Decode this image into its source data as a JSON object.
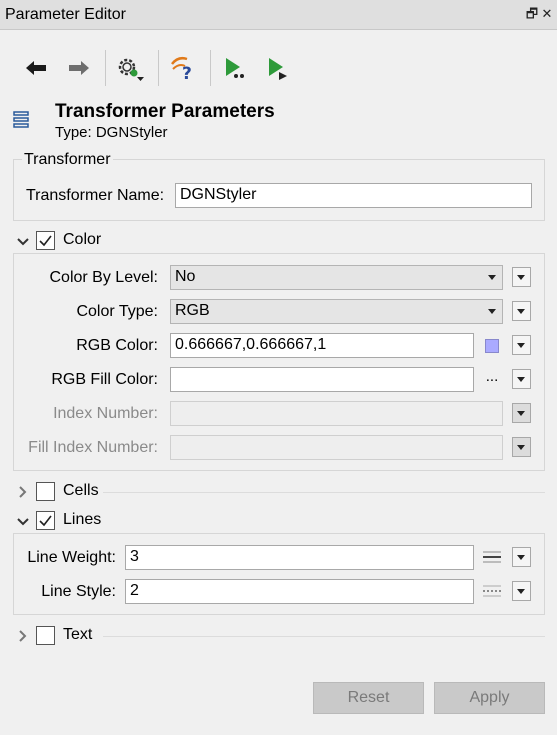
{
  "window": {
    "title": "Parameter Editor",
    "float_glyph": "🗗",
    "close_glyph": "✕"
  },
  "toolbar": {
    "buttons": [
      {
        "name": "back-arrow-icon"
      },
      {
        "name": "forward-arrow-icon"
      },
      {
        "name": "settings-gear-icon"
      },
      {
        "name": "help-icon"
      },
      {
        "name": "run-icon"
      },
      {
        "name": "run-to-this-icon"
      }
    ]
  },
  "header": {
    "title": "Transformer Parameters",
    "type_label": "Type: DGNStyler"
  },
  "transformer_group": {
    "legend": "Transformer",
    "name_label": "Transformer Name:",
    "name_value": "DGNStyler"
  },
  "color_section": {
    "label": "Color",
    "checked": true,
    "expanded": true,
    "color_by_level": {
      "label": "Color By Level:",
      "value": "No"
    },
    "color_type": {
      "label": "Color Type:",
      "value": "RGB"
    },
    "rgb_color": {
      "label": "RGB Color:",
      "value": "0.666667,0.666667,1",
      "swatch": "#aaaaff"
    },
    "rgb_fill_color": {
      "label": "RGB Fill Color:",
      "value": "",
      "browse": "..."
    },
    "index_number": {
      "label": "Index Number:",
      "value": ""
    },
    "fill_index_number": {
      "label": "Fill Index Number:",
      "value": ""
    }
  },
  "cells_section": {
    "label": "Cells",
    "checked": false,
    "expanded": false
  },
  "lines_section": {
    "label": "Lines",
    "checked": true,
    "expanded": true,
    "line_weight": {
      "label": "Line Weight:",
      "value": "3"
    },
    "line_style": {
      "label": "Line Style:",
      "value": "2"
    }
  },
  "text_section": {
    "label": "Text",
    "checked": false,
    "expanded": false
  },
  "buttons": {
    "reset": "Reset",
    "apply": "Apply"
  },
  "colors": {
    "accent_green": "#2e9a3a",
    "check": "#222222"
  }
}
